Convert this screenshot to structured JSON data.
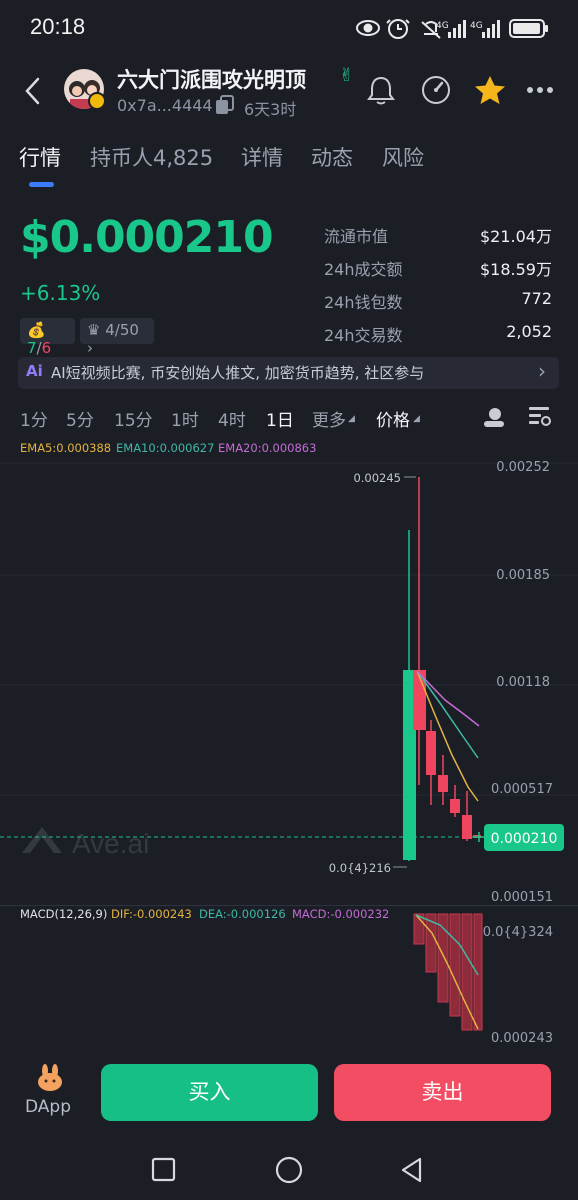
{
  "status": {
    "time": "20:18"
  },
  "token": {
    "name": "六大门派围攻光明顶",
    "address": "0x7a...4444",
    "age": "6天3时"
  },
  "tabs": [
    {
      "label": "行情"
    },
    {
      "label": "持币人4,825"
    },
    {
      "label": "详情"
    },
    {
      "label": "动态"
    },
    {
      "label": "风险"
    }
  ],
  "price": {
    "value": "$0.000210",
    "change": "+6.13%"
  },
  "chips": {
    "chip1_a": "7",
    "chip1_sep": "/",
    "chip1_b": "6",
    "chip2": "4/50"
  },
  "stats": [
    {
      "label": "流通市值",
      "value": "$21.04万"
    },
    {
      "label": "24h成交额",
      "value": "$18.59万"
    },
    {
      "label": "24h钱包数",
      "value": "772"
    },
    {
      "label": "24h交易数",
      "value": "2,052"
    }
  ],
  "banner": {
    "ai": "Ai",
    "text": "AI短视频比赛, 币安创始人推文, 加密货币趋势, 社区参与"
  },
  "timeframes": [
    "1分",
    "5分",
    "15分",
    "1时",
    "4时",
    "1日",
    "更多",
    "价格"
  ],
  "ema": {
    "ema5": "EMA5:0.000388",
    "ema10": "EMA10:0.000627",
    "ema20": "EMA20:0.000863"
  },
  "axis": {
    "p1": "0.00252",
    "p2": "0.00185",
    "p3": "0.00118",
    "p4": "0.000517",
    "p5": "0.000151",
    "current": "0.000210",
    "high": "0.00245",
    "low": "0.0{4}216",
    "watermark": "Ave.ai"
  },
  "macd": {
    "label": "MACD(12,26,9)",
    "dif": "DIF:-0.000243",
    "dea": "DEA:-0.000126",
    "macd": "MACD:-0.000232",
    "top": "0.0{4}324",
    "bottom": "0.000243"
  },
  "actions": {
    "dapp": "DApp",
    "buy": "买入",
    "sell": "卖出"
  },
  "colors": {
    "up": "#19c78a",
    "down": "#f0455e",
    "accent": "#3b7bff",
    "bg": "#1c1e26"
  }
}
